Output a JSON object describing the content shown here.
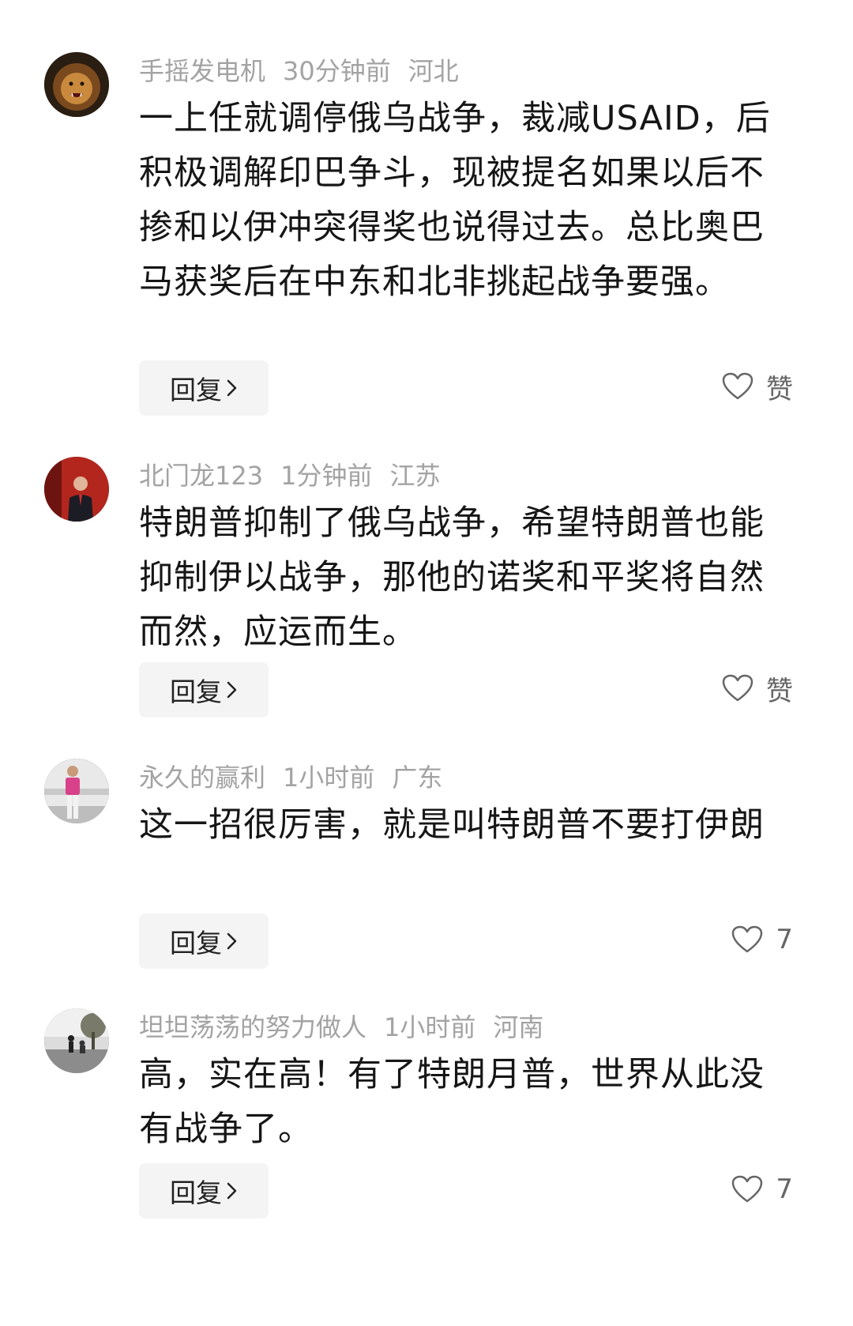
{
  "comments": [
    {
      "user": "手摇发电机",
      "time": "30分钟前",
      "region": "河北",
      "text": "一上任就调停俄乌战争，裁减USAID，后积极调解印巴争斗，现被提名如果以后不掺和以伊冲突得奖也说得过去。总比奥巴马获奖后在中东和北非挑起战争要强。",
      "reply_label": "回复",
      "like_label": "赞",
      "avatar_icon": "lion-avatar-icon"
    },
    {
      "user": "北门龙123",
      "time": "1分钟前",
      "region": "江苏",
      "text": "特朗普抑制了俄乌战争，希望特朗普也能抑制伊以战争，那他的诺奖和平奖将自然而然，应运而生。",
      "reply_label": "回复",
      "like_label": "赞",
      "avatar_icon": "man-red-background-avatar-icon"
    },
    {
      "user": "永久的赢利",
      "time": "1小时前",
      "region": "广东",
      "text": "这一招很厉害，就是叫特朗普不要打伊朗",
      "reply_label": "回复",
      "like_label": "7",
      "avatar_icon": "man-pink-shirt-avatar-icon"
    },
    {
      "user": "坦坦荡荡的努力做人",
      "time": "1小时前",
      "region": "河南",
      "text": "高，实在高！有了特朗月普，世界从此没有战争了。",
      "reply_label": "回复",
      "like_label": "7",
      "avatar_icon": "park-people-avatar-icon"
    }
  ]
}
